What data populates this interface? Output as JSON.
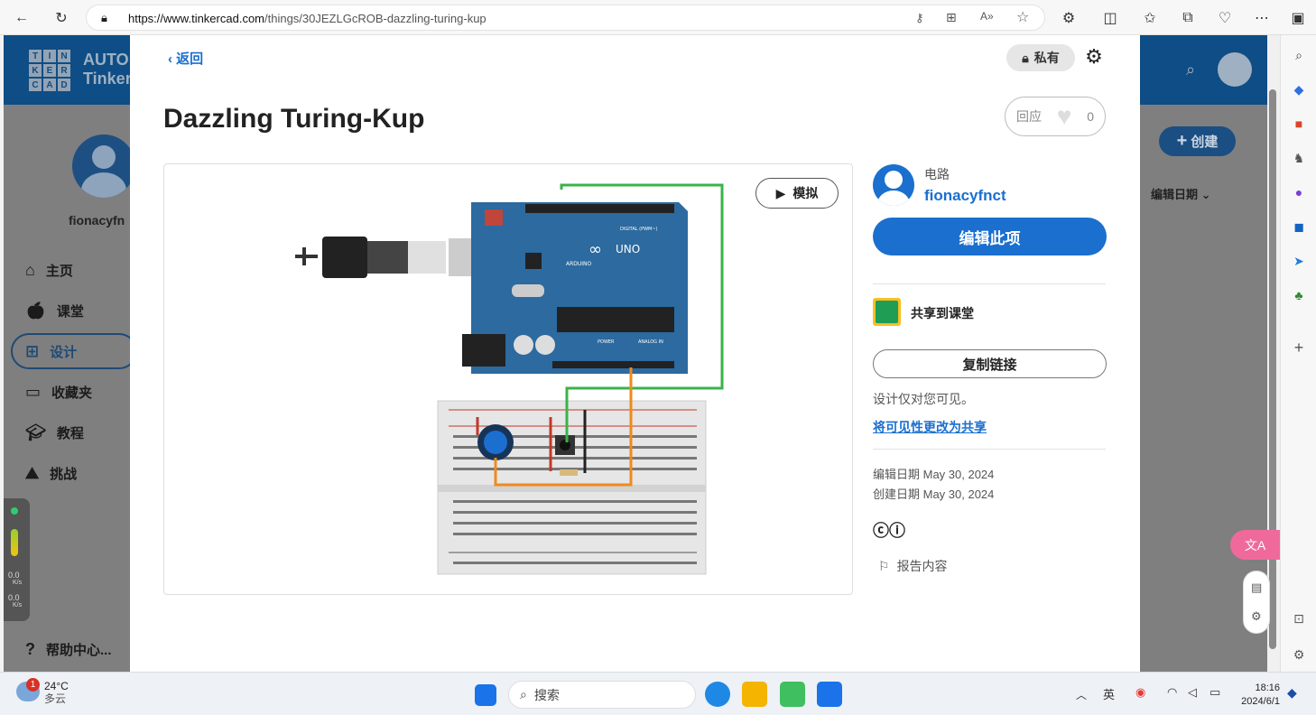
{
  "browser": {
    "url_host": "https://www.tinkercad.com",
    "url_path": "/things/30JEZLGcROB-dazzling-turing-kup"
  },
  "background": {
    "brand_line1": "AUTO",
    "brand_line2": "Tinker",
    "logo_letters": [
      "T",
      "I",
      "N",
      "K",
      "E",
      "R",
      "C",
      "A",
      "D"
    ],
    "username": "fionacyfn",
    "nav": [
      {
        "label": "主页",
        "icon": "home-icon"
      },
      {
        "label": "课堂",
        "icon": "apple-icon"
      },
      {
        "label": "设计",
        "icon": "grid-icon"
      },
      {
        "label": "收藏夹",
        "icon": "folder-icon"
      },
      {
        "label": "教程",
        "icon": "graduation-cap-icon"
      },
      {
        "label": "挑战",
        "icon": "mountain-icon"
      }
    ],
    "help": "帮助中心...",
    "create": "创建",
    "sort_label": "编辑日期",
    "widget": {
      "up": "0.0",
      "down": "0.0",
      "unit": "K/s"
    }
  },
  "modal": {
    "back": "返回",
    "privacy": "私有",
    "title": "Dazzling Turing-Kup",
    "like_label": "回应",
    "like_count": "0",
    "simulate": "模拟",
    "category": "电路",
    "author": "fionacyfnct",
    "edit": "编辑此项",
    "share_class": "共享到课堂",
    "copy_link": "复制链接",
    "visibility_note": "设计仅对您可见。",
    "visibility_link": "将可见性更改为共享",
    "edited": "编辑日期 May 30, 2024",
    "created": "创建日期 May 30, 2024",
    "license": "ⓒⓘ",
    "report": "报告内容"
  },
  "circuit": {
    "board_text": "UNO",
    "board_brand": "ARDUINO",
    "digital_label": "DIGITAL (PWM~)",
    "analog_label": "ANALOG IN",
    "power_label": "POWER"
  },
  "translate_button": "文A",
  "taskbar": {
    "temp": "24°C",
    "weather": "多云",
    "weather_badge": "1",
    "search": "搜索",
    "time": "18:16",
    "date": "2024/6/1"
  }
}
